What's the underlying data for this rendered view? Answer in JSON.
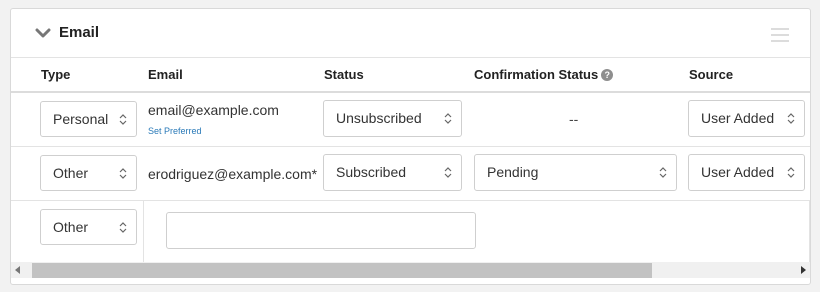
{
  "panel": {
    "title": "Email"
  },
  "columns": {
    "type": "Type",
    "email": "Email",
    "status": "Status",
    "confirmation_status": "Confirmation Status",
    "source": "Source"
  },
  "rows": [
    {
      "type": "Personal",
      "email": "email@example.com",
      "set_preferred": "Set Preferred",
      "status": "Unsubscribed",
      "confirmation_status": "--",
      "source": "User Added"
    },
    {
      "type": "Other",
      "email": "erodriguez@example.com*",
      "status": "Subscribed",
      "confirmation_status": "Pending",
      "source": "User Added"
    },
    {
      "type": "Other",
      "email_input": ""
    }
  ],
  "icons": {
    "collapse": "chevron-down-icon",
    "menu": "hamburger-menu-icon",
    "help": "question-circle-icon",
    "caret": "up-down-caret-icon"
  },
  "colors": {
    "link": "#2a7ab8",
    "scroll_thumb": "#c2c2c2"
  }
}
